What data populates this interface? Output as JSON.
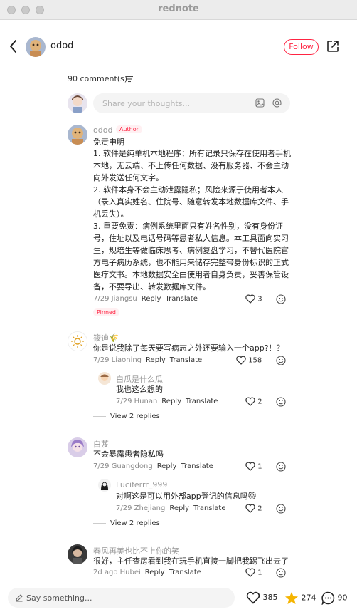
{
  "window": {
    "title": "rednote"
  },
  "post": {
    "author": "odod",
    "follow_label": "Follow"
  },
  "comments_header": {
    "count_label": "90 comment(s)"
  },
  "composer": {
    "placeholder": "Share your thoughts..."
  },
  "comments": [
    {
      "name": "odod",
      "author_badge": "Author",
      "pinned_badge": "Pinned",
      "lines": [
        "免责申明",
        "1. 软件是纯单机本地程序：所有记录只保存在使用者手机",
        "本地，无云端、不上传任何数据、没有服务器、不会主动",
        "向外发送任何文字。",
        "2. 软件本身不会主动泄露隐私；风险来源于使用者本人",
        "（录入真实姓名、住院号、随意转发本地数据库文件、手",
        "机丢失）。",
        "3. 重要免责：病例系统里面只有姓名性别，没有身份证",
        "号，住址以及电话号码等患者私人信息。本工具面向实习",
        "生，规培生等做临床思考、病例复盘学习，不替代医院官",
        "方电子病历系统，也不能用来储存完整带身份标识的正式",
        "医疗文书。本地数据安全由使用者自身负责，妥善保管设",
        "备，不要导出、转发数据库文件。"
      ],
      "meta": "7/29 Jiangsu",
      "reply": "Reply",
      "translate": "Translate",
      "likes": "3"
    },
    {
      "name": "筱迪🌾",
      "text": "你是说我除了每天要写病志之外还要输入一个app?！？",
      "meta": "7/29 Liaoning",
      "reply": "Reply",
      "translate": "Translate",
      "likes": "158",
      "sub": {
        "name": "白瓜是什么瓜",
        "text": "我也这么想的",
        "meta": "7/29 Hunan",
        "reply": "Reply",
        "translate": "Translate",
        "likes": "2"
      },
      "view_replies": "View 2 replies"
    },
    {
      "name": "白芨",
      "text": "不会暴露患者隐私吗",
      "meta": "7/29 Guangdong",
      "reply": "Reply",
      "translate": "Translate",
      "likes": "1",
      "sub": {
        "name": "Luciferrr_999",
        "text": "对啊这是可以用外部app登记的信息吗🐱",
        "meta": "7/29 Zhejiang",
        "reply": "Reply",
        "translate": "Translate",
        "likes": "2"
      },
      "view_replies": "View 2 replies"
    },
    {
      "name": "春风再美也比不上你的笑",
      "text": "很好，主任查房看到我在玩手机直接一脚把我踢飞出去了",
      "meta": "2d ago Hubei",
      "reply": "Reply",
      "translate": "Translate",
      "likes": "1"
    }
  ],
  "footer": {
    "say_placeholder": "Say something...",
    "likes": "385",
    "stars": "274",
    "comments": "90"
  },
  "colors": {
    "accent": "#ff2442",
    "star": "#f5b400"
  }
}
